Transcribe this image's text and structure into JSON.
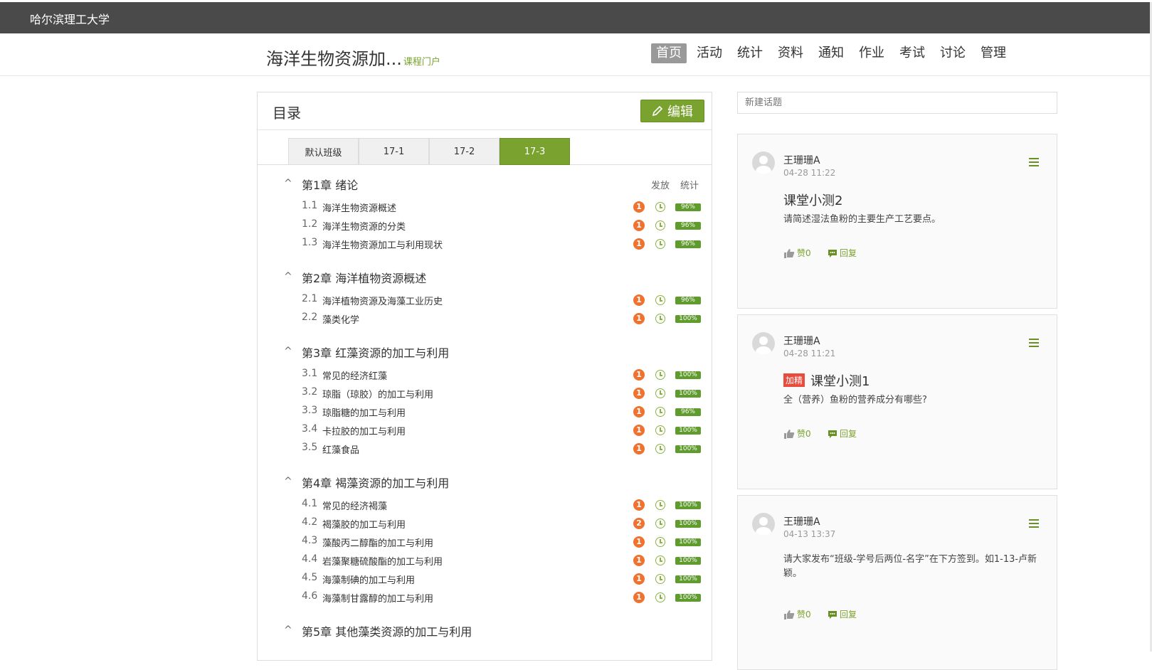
{
  "topbar": {
    "school": "哈尔滨理工大学"
  },
  "header": {
    "course_title": "海洋生物资源加...",
    "course_portal": "课程门户",
    "nav": [
      "首页",
      "活动",
      "统计",
      "资料",
      "通知",
      "作业",
      "考试",
      "讨论",
      "管理"
    ],
    "active_nav": "首页"
  },
  "catalog": {
    "title": "目录",
    "edit_label": "编辑",
    "tabs": [
      "默认班级",
      "17-1",
      "17-2",
      "17-3"
    ],
    "active_tab": "17-3",
    "col_publish": "发放",
    "col_stats": "统计",
    "chapters": [
      {
        "title": "第1章 绪论",
        "sections": [
          {
            "num": "1.1",
            "title": "海洋生物资源概述",
            "badge": "1",
            "pct": "96%"
          },
          {
            "num": "1.2",
            "title": "海洋生物资源的分类",
            "badge": "1",
            "pct": "96%"
          },
          {
            "num": "1.3",
            "title": "海洋生物资源加工与利用现状",
            "badge": "1",
            "pct": "96%"
          }
        ]
      },
      {
        "title": "第2章 海洋植物资源概述",
        "sections": [
          {
            "num": "2.1",
            "title": "海洋植物资源及海藻工业历史",
            "badge": "1",
            "pct": "96%"
          },
          {
            "num": "2.2",
            "title": "藻类化学",
            "badge": "1",
            "pct": "100%"
          }
        ]
      },
      {
        "title": "第3章 红藻资源的加工与利用",
        "sections": [
          {
            "num": "3.1",
            "title": "常见的经济红藻",
            "badge": "1",
            "pct": "100%"
          },
          {
            "num": "3.2",
            "title": "琼脂（琼胶）的加工与利用",
            "badge": "1",
            "pct": "100%"
          },
          {
            "num": "3.3",
            "title": "琼脂糖的加工与利用",
            "badge": "1",
            "pct": "96%"
          },
          {
            "num": "3.4",
            "title": "卡拉胶的加工与利用",
            "badge": "1",
            "pct": "100%"
          },
          {
            "num": "3.5",
            "title": "红藻食品",
            "badge": "1",
            "pct": "100%"
          }
        ]
      },
      {
        "title": "第4章 褐藻资源的加工与利用",
        "sections": [
          {
            "num": "4.1",
            "title": "常见的经济褐藻",
            "badge": "1",
            "pct": "100%"
          },
          {
            "num": "4.2",
            "title": "褐藻胶的加工与利用",
            "badge": "2",
            "pct": "100%"
          },
          {
            "num": "4.3",
            "title": "藻酸丙二醇酯的加工与利用",
            "badge": "1",
            "pct": "100%"
          },
          {
            "num": "4.4",
            "title": "岩藻聚糖硫酸酯的加工与利用",
            "badge": "1",
            "pct": "100%"
          },
          {
            "num": "4.5",
            "title": "海藻制碘的加工与利用",
            "badge": "1",
            "pct": "100%"
          },
          {
            "num": "4.6",
            "title": "海藻制甘露醇的加工与利用",
            "badge": "1",
            "pct": "100%"
          }
        ]
      },
      {
        "title": "第5章 其他藻类资源的加工与利用",
        "sections": []
      }
    ]
  },
  "discussion": {
    "new_topic_placeholder": "新建话题",
    "posts": [
      {
        "author": "王珊珊A",
        "time": "04-28 11:22",
        "title": "课堂小测2",
        "hot": "",
        "body": "请简述湿法鱼粉的主要生产工艺要点。",
        "likes": "赞0",
        "reply": "回复"
      },
      {
        "author": "王珊珊A",
        "time": "04-28 11:21",
        "title": "课堂小测1",
        "hot": "加精",
        "body": "全（营养）鱼粉的营养成分有哪些?",
        "likes": "赞0",
        "reply": "回复"
      },
      {
        "author": "王珊珊A",
        "time": "04-13 13:37",
        "title": "",
        "hot": "",
        "body": "请大家发布“班级-学号后两位-名字”在下方签到。如1-13-卢新颖。",
        "likes": "赞0",
        "reply": "回复"
      }
    ]
  },
  "colors": {
    "accent": "#7aa22f",
    "badge": "#f0722f",
    "topbar": "#4a4a4a"
  }
}
